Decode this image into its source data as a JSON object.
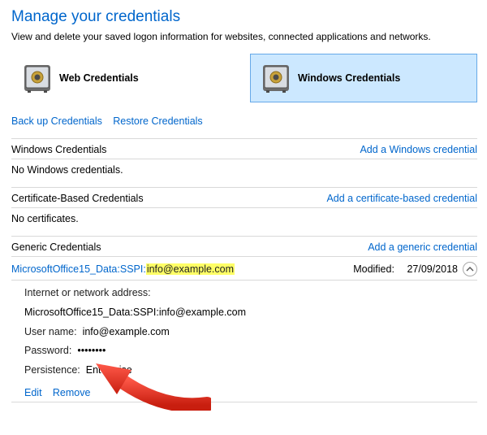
{
  "header": {
    "title": "Manage your credentials",
    "subtitle": "View and delete your saved logon information for websites, connected applications and networks."
  },
  "tiles": {
    "web": {
      "label": "Web Credentials",
      "selected": false,
      "icon": "safe-icon"
    },
    "windows": {
      "label": "Windows Credentials",
      "selected": true,
      "icon": "safe-icon"
    }
  },
  "links": {
    "backup": "Back up Credentials",
    "restore": "Restore Credentials"
  },
  "sections": {
    "windows": {
      "title": "Windows Credentials",
      "add": "Add a Windows credential",
      "empty": "No Windows credentials."
    },
    "cert": {
      "title": "Certificate-Based Credentials",
      "add": "Add a certificate-based credential",
      "empty": "No certificates."
    },
    "generic": {
      "title": "Generic Credentials",
      "add": "Add a generic credential",
      "entries": [
        {
          "name_prefix": "MicrosoftOffice15_Data:SSPI:",
          "name_highlight": "info@example.com",
          "modified_label": "Modified:",
          "modified_value": "27/09/2018",
          "details": {
            "address_label": "Internet or network address:",
            "address_value": "MicrosoftOffice15_Data:SSPI:info@example.com",
            "user_label": "User name:",
            "user_value": "info@example.com",
            "pass_label": "Password:",
            "pass_value": "••••••••",
            "persist_label": "Persistence:",
            "persist_value": "Enterprise"
          },
          "actions": {
            "edit": "Edit",
            "remove": "Remove"
          }
        }
      ]
    }
  }
}
